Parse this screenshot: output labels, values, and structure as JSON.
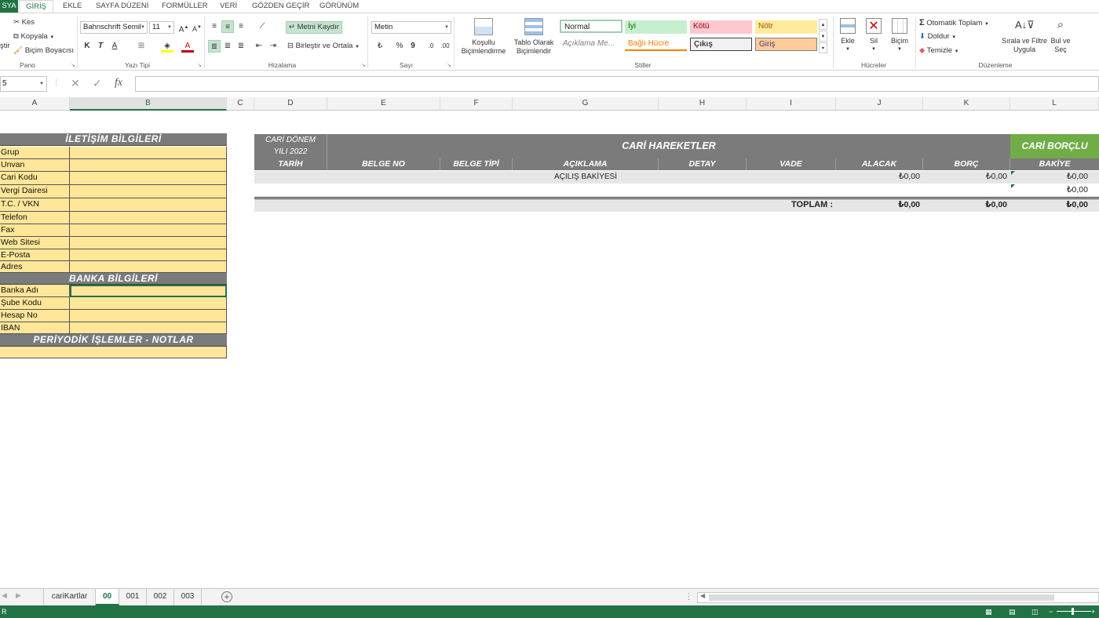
{
  "ribbon_tabs": [
    "SYA",
    "GİRİŞ",
    "EKLE",
    "SAYFA DÜZENİ",
    "FORMÜLLER",
    "VERİ",
    "GÖZDEN GEÇİR",
    "GÖRÜNÜM"
  ],
  "clipboard": {
    "cut": "Kes",
    "copy": "Kopyala",
    "paste_partial": "ştir",
    "format_painter": "Biçim Boyacısı",
    "group": "Pano"
  },
  "font": {
    "name": "Bahnschrift Semil",
    "size": "11",
    "bold": "K",
    "italic": "T",
    "underline": "A",
    "group": "Yazı Tipi"
  },
  "alignment": {
    "wrap_text": "Metni Kaydır",
    "merge_center": "Birleştir ve Ortala",
    "group": "Hizalama"
  },
  "number": {
    "format": "Metin",
    "percent": "%",
    "comma": "9",
    "group": "Sayı"
  },
  "styles_group": {
    "conditional": "Koşullu Biçimlendirme",
    "table": "Tablo Olarak Biçimlendir",
    "cells": [
      {
        "label": "Normal",
        "bg": "#ffffff",
        "fg": "#000000"
      },
      {
        "label": "İyi",
        "bg": "#c6efce",
        "fg": "#006100"
      },
      {
        "label": "Kötü",
        "bg": "#ffc7ce",
        "fg": "#9c0006"
      },
      {
        "label": "Nötr",
        "bg": "#ffeb9c",
        "fg": "#9c5700"
      },
      {
        "label": "Açıklama Me...",
        "bg": "#ffffff",
        "fg": "#7f7f7f"
      },
      {
        "label": "Bağlı Hücre",
        "bg": "#ffffff",
        "fg": "#fa7d00"
      },
      {
        "label": "Çıkış",
        "bg": "#f2f2f2",
        "fg": "#3f3f3f"
      },
      {
        "label": "Giriş",
        "bg": "#ffcc99",
        "fg": "#3f3f76"
      }
    ],
    "group": "Stiller"
  },
  "cells_group": {
    "insert": "Ekle",
    "delete": "Sil",
    "format": "Biçim",
    "group": "Hücreler"
  },
  "editing": {
    "autosum": "Otomatik Toplam",
    "fill": "Doldur",
    "clear": "Temizle",
    "sort_filter": "Sırala ve Filtre Uygula",
    "find_select": "Bul ve Seç",
    "group": "Düzenleme"
  },
  "formula_bar": {
    "name_box": "5",
    "fx": "fx"
  },
  "columns": [
    "A",
    "B",
    "C",
    "D",
    "E",
    "F",
    "G",
    "H",
    "I",
    "J",
    "K",
    "L"
  ],
  "left_table": {
    "contact_header": "İLETİŞİM BİLGİLERİ",
    "contact_rows": [
      "Grup",
      "Unvan",
      "Cari Kodu",
      "Vergi Dairesi",
      "T.C. / VKN",
      "Telefon",
      "Fax",
      "Web Sitesi",
      "E-Posta",
      "Adres"
    ],
    "bank_header": "BANKA BİLGİLERİ",
    "bank_rows": [
      "Banka Adı",
      "Şube Kodu",
      "Hesap No",
      "IBAN"
    ],
    "notes_header": "PERİYODİK İŞLEMLER - NOTLAR"
  },
  "right_table": {
    "period_label": "CARİ DÖNEM YILI 2022",
    "title": "CARİ HAREKETLER",
    "status_badge": "CARİ BORÇLU",
    "status_color": "#70ad47",
    "headers": [
      "TARİH",
      "BELGE NO",
      "BELGE TİPİ",
      "AÇIKLAMA",
      "DETAY",
      "VADE",
      "ALACAK",
      "BORÇ",
      "BAKİYE"
    ],
    "opening_row": {
      "description": "AÇILIŞ BAKİYESİ",
      "credit": "₺0,00",
      "debit": "₺0,00",
      "balance": "₺0,00"
    },
    "second_row_balance": "₺0,00",
    "total": {
      "label": "TOPLAM :",
      "credit": "₺0,00",
      "debit": "₺0,00",
      "balance": "₺0,00"
    }
  },
  "sheet_tabs": [
    "cariKartlar",
    "00",
    "001",
    "002",
    "003"
  ],
  "active_sheet": "00",
  "status_text": "R"
}
